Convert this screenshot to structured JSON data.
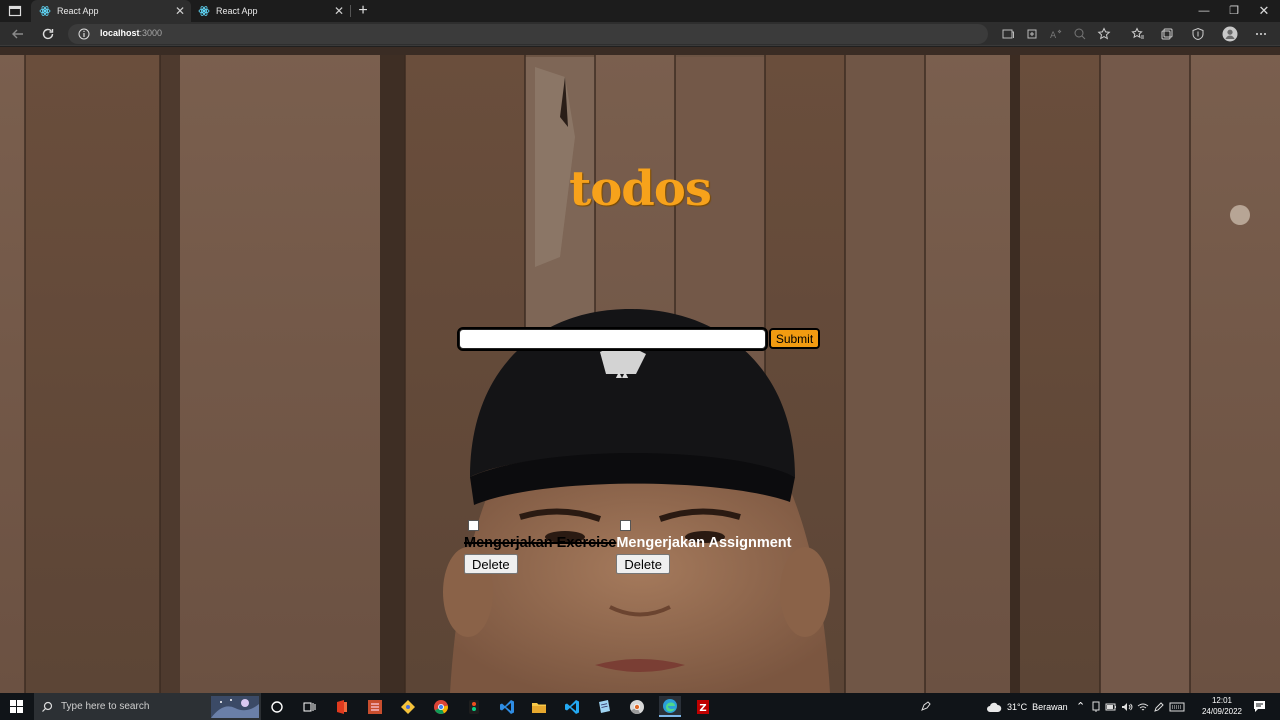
{
  "browser": {
    "tabs": [
      {
        "title": "React App",
        "active": true
      },
      {
        "title": "React App",
        "active": false
      }
    ],
    "url_host": "localhost",
    "url_port": ":3000"
  },
  "app": {
    "title": "todos",
    "input_value": "",
    "submit_label": "Submit",
    "todos": [
      {
        "text": "Mengerjakan Exercise",
        "completed": true,
        "delete_label": "Delete"
      },
      {
        "text": "Mengerjakan Assignment",
        "completed": false,
        "delete_label": "Delete"
      }
    ]
  },
  "taskbar": {
    "search_placeholder": "Type here to search",
    "weather": "31°C  Berawan",
    "time": "12:01",
    "date": "24/09/2022",
    "apps": [
      "cortana-icon",
      "task-view-icon",
      "office-icon",
      "sublime-icon",
      "git-icon",
      "chrome-icon",
      "figma-icon",
      "vscode-icon",
      "file-explorer-icon",
      "vscode-insiders-icon",
      "notepad-icon",
      "chrome-dev-icon",
      "edge-icon",
      "filezilla-icon"
    ]
  },
  "colors": {
    "title": "#f7a21b",
    "submit": "#f29b11"
  }
}
